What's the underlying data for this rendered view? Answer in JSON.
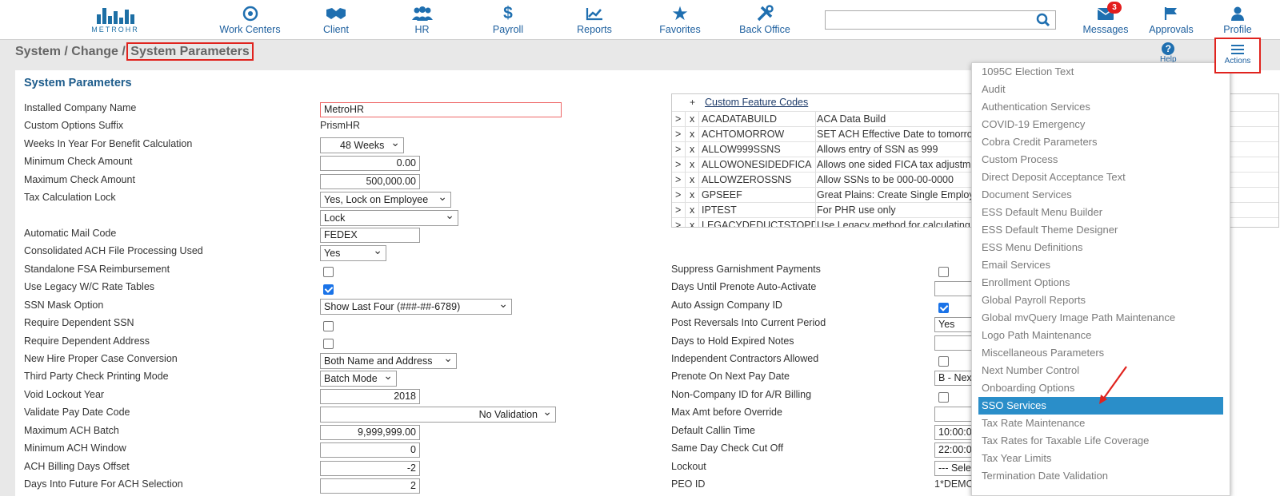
{
  "nav": {
    "logo_text": "METROHR",
    "items": [
      {
        "label": "Work Centers",
        "icon": "work-centers-icon"
      },
      {
        "label": "Client",
        "icon": "handshake-icon"
      },
      {
        "label": "HR",
        "icon": "people-icon"
      },
      {
        "label": "Payroll",
        "icon": "dollar-icon"
      },
      {
        "label": "Reports",
        "icon": "chart-icon"
      },
      {
        "label": "Favorites",
        "icon": "star-icon"
      },
      {
        "label": "Back Office",
        "icon": "tools-icon"
      }
    ],
    "search_value": "",
    "right_items": [
      {
        "label": "Messages",
        "icon": "envelope-icon",
        "badge": "3"
      },
      {
        "label": "Approvals",
        "icon": "flag-icon"
      },
      {
        "label": "Profile",
        "icon": "user-icon"
      }
    ]
  },
  "breadcrumb": {
    "path": "System / Change / ",
    "current": "System Parameters"
  },
  "toolbar": {
    "help_label": "Help",
    "actions_label": "Actions"
  },
  "panel": {
    "title": "System Parameters",
    "fields_left": [
      {
        "label": "Installed Company Name",
        "value": "MetroHR"
      },
      {
        "label": "Custom Options Suffix",
        "value": "PrismHR"
      },
      {
        "label": "Weeks In Year For Benefit Calculation",
        "value": "48 Weeks"
      },
      {
        "label": "Minimum Check Amount",
        "value": "0.00"
      },
      {
        "label": "Maximum Check Amount",
        "value": "500,000.00"
      },
      {
        "label": "Tax Calculation Lock",
        "value": "Yes, Lock on Employee",
        "value2": "Lock"
      },
      {
        "label": "Automatic Mail Code",
        "value": "FEDEX"
      },
      {
        "label": "Consolidated ACH File Processing Used",
        "value": "Yes"
      },
      {
        "label": "Standalone FSA Reimbursement",
        "checked": false
      },
      {
        "label": "Use Legacy W/C Rate Tables",
        "checked": true
      },
      {
        "label": "SSN Mask Option",
        "value": "Show Last Four (###-##-6789)"
      },
      {
        "label": "Require Dependent SSN",
        "checked": false
      },
      {
        "label": "Require Dependent Address",
        "checked": false
      },
      {
        "label": "New Hire Proper Case Conversion",
        "value": "Both Name and Address"
      },
      {
        "label": "Third Party Check Printing Mode",
        "value": "Batch Mode"
      },
      {
        "label": "Void Lockout Year",
        "value": "2018"
      },
      {
        "label": "Validate Pay Date Code",
        "value": "No Validation"
      },
      {
        "label": "Maximum ACH Batch",
        "value": "9,999,999.00"
      },
      {
        "label": "Minimum ACH Window",
        "value": "0"
      },
      {
        "label": "ACH Billing Days Offset",
        "value": "-2"
      },
      {
        "label": "Days Into Future For ACH Selection",
        "value": "2"
      }
    ],
    "fields_right": [
      {
        "label": "Suppress Garnishment Payments",
        "checked": false
      },
      {
        "label": "Days Until Prenote Auto-Activate",
        "value": ""
      },
      {
        "label": "Auto Assign Company ID",
        "checked": true
      },
      {
        "label": "Post Reversals Into Current Period",
        "value": "Yes"
      },
      {
        "label": "Days to Hold Expired Notes",
        "value": ""
      },
      {
        "label": "Independent Contractors Allowed",
        "checked": false
      },
      {
        "label": "Prenote On Next Pay Date",
        "value": "B - Nex"
      },
      {
        "label": "Non-Company ID for A/R Billing",
        "checked": false
      },
      {
        "label": "Max Amt before Override",
        "value": ""
      },
      {
        "label": "Default Callin Time",
        "value": "10:00:0"
      },
      {
        "label": "Same Day Check Cut Off",
        "value": "22:00:0"
      },
      {
        "label": "Lockout",
        "value": "--- Sele"
      },
      {
        "label": "PEO ID",
        "value": "1*DEMO"
      }
    ],
    "feature_codes": {
      "title": "Custom Feature Codes",
      "plus": "+",
      "rows": [
        {
          "code": "ACADATABUILD",
          "desc": "ACA Data Build"
        },
        {
          "code": "ACHTOMORROW",
          "desc": "SET ACH Effective Date to tomorrow"
        },
        {
          "code": "ALLOW999SSNS",
          "desc": "Allows entry of SSN as 999"
        },
        {
          "code": "ALLOWONESIDEDFICA",
          "desc": "Allows one sided FICA tax adjustment"
        },
        {
          "code": "ALLOWZEROSSNS",
          "desc": "Allow SSNs to be 000-00-0000"
        },
        {
          "code": "GPSEEF",
          "desc": "Great Plains: Create Single Employee"
        },
        {
          "code": "IPTEST",
          "desc": "For PHR use only"
        },
        {
          "code": "LEGACYDEDUCTSTOPD",
          "desc": "Use Legacy method for calculating"
        }
      ]
    }
  },
  "actions_menu": {
    "selected": "SSO Services",
    "items": [
      "1095C Election Text",
      "Audit",
      "Authentication Services",
      "COVID-19 Emergency",
      "Cobra Credit Parameters",
      "Custom Process",
      "Direct Deposit Acceptance Text",
      "Document Services",
      "ESS Default Menu Builder",
      "ESS Default Theme Designer",
      "ESS Menu Definitions",
      "Email Services",
      "Enrollment Options",
      "Global Payroll Reports",
      "Global mvQuery Image Path Maintenance",
      "Logo Path Maintenance",
      "Miscellaneous Parameters",
      "Next Number Control",
      "Onboarding Options",
      "SSO Services",
      "Tax Rate Maintenance",
      "Tax Rates for Taxable Life Coverage",
      "Tax Year Limits",
      "Termination Date Validation"
    ]
  },
  "colors": {
    "brand_blue": "#1f6fb0",
    "highlight_red": "#e0231e",
    "selected_item": "#2a8ec9"
  }
}
